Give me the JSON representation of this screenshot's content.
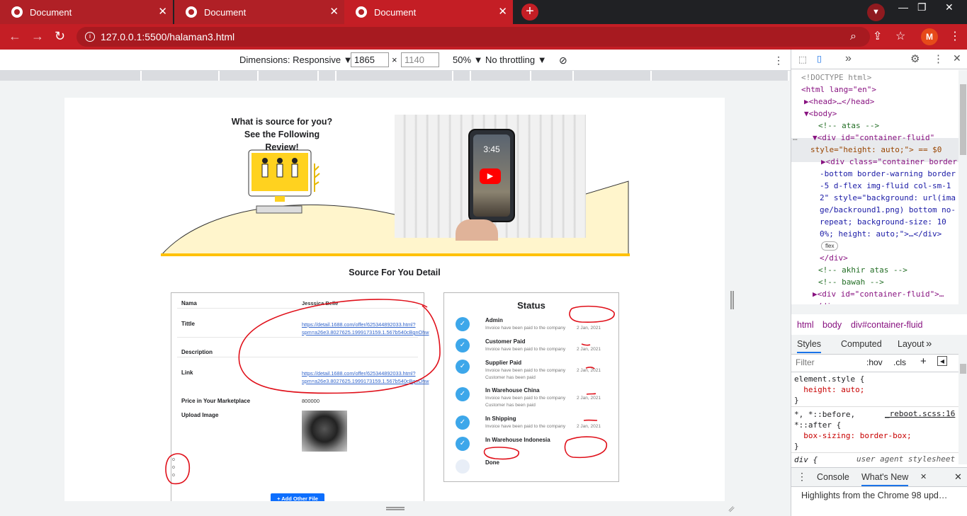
{
  "browser": {
    "tabs": [
      {
        "title": "Document"
      },
      {
        "title": "Document"
      },
      {
        "title": "Document"
      }
    ],
    "new_tab_icon": "+",
    "url": "127.0.0.1:5500/halaman3.html",
    "profile_initial": "M"
  },
  "device_toolbar": {
    "dimensions": "Dimensions: Responsive ▼",
    "width": "1865",
    "height": "1140",
    "times": "×",
    "zoom": "50% ▼",
    "throttle": "No throttling ▼"
  },
  "page": {
    "hero_title_1": "What is source for you?",
    "hero_title_2": "See the Following Review!",
    "section_title": "Source For You Detail",
    "detail": {
      "nama_label": "Nama",
      "nama_value": "Jesssica Belle",
      "tittle_label": "Tittle",
      "tittle_link_1": "https://detail.1688.com/offer/625344892033.html?",
      "tittle_link_2": "spm=a26e3.8027625.1999173159.1.567b540cBgnOhw",
      "description_label": "Description",
      "link_label": "Link",
      "link_1": "https://detail.1688.com/offer/625344892033.html?",
      "link_2": "spm=a26e3.8027625.1999173159.1.567b540cBgnOhw",
      "price_label": "Price in Your Marketplace",
      "price_value": "800000",
      "upload_label": "Upload Image",
      "add_button": "+ Add Other File"
    },
    "status": {
      "title": "Status",
      "items": [
        {
          "name": "Admin",
          "desc": "Invoice have been paid to the company",
          "desc2": "",
          "date": "2 Jan, 2021",
          "done": true
        },
        {
          "name": "Customer Paid",
          "desc": "Invoice have been paid to the company",
          "desc2": "",
          "date": "2 Jan, 2021",
          "done": true
        },
        {
          "name": "Supplier Paid",
          "desc": "Invoice have been paid to the company",
          "desc2": "Customer has been paid",
          "date": "2 Jan, 2021",
          "done": true
        },
        {
          "name": "In Warehouse China",
          "desc": "Invoice have been paid to the company",
          "desc2": "Customer has been paid",
          "date": "2 Jan, 2021",
          "done": true
        },
        {
          "name": "In Shipping",
          "desc": "Invoice have been paid to the company",
          "desc2": "",
          "date": "2 Jan, 2021",
          "done": true
        },
        {
          "name": "In Warehouse Indonesia",
          "desc": "",
          "desc2": "",
          "date": "",
          "done": true
        },
        {
          "name": "Done",
          "desc": "",
          "desc2": "",
          "date": "",
          "done": false
        }
      ]
    },
    "phone_time": "3:45"
  },
  "devtools": {
    "elements": [
      "<!DOCTYPE html>",
      "<html lang=\"en\">",
      "▶<head>…</head>",
      "▼<body>",
      "<!-- atas -->",
      "▼<div id=\"container-fluid\"",
      "style=\"height: auto;\"> == $0",
      "▶<div class=\"container border",
      "-bottom border-warning border",
      "-5 d-flex img-fluid col-sm-1",
      "2\" style=\"background: url(ima",
      "ge/backround1.png) bottom no-",
      "repeat; background-size: 10",
      "0%; height: auto;\">…</div>",
      "flex",
      "</div>",
      "<!-- akhir atas -->",
      "<!-- bawah -->",
      "▶<div id=\"container-fluid\">…",
      "</div>"
    ],
    "breadcrumb": [
      "html",
      "body",
      "div#container-fluid"
    ],
    "styles_tabs": [
      "Styles",
      "Computed",
      "Layout",
      "»"
    ],
    "filter_placeholder": "Filter",
    "hov": ":hov",
    "cls": ".cls",
    "css_lines": [
      "element.style {",
      "  height: auto;",
      "}",
      "*, *::before,",
      "*::after {",
      "  box-sizing: border-box;",
      "}",
      "div {"
    ],
    "reboot_link": "_reboot.scss:16",
    "user_agent": "user agent stylesheet",
    "drawer_tabs": [
      "Console",
      "What's New"
    ],
    "drawer_text": "Highlights from the Chrome 98 upd…"
  },
  "colors": {
    "chrome_red": "#c41e25",
    "accent_yellow": "#ffc107",
    "status_blue": "#3da7ea",
    "annotation_red": "#e0101a"
  }
}
